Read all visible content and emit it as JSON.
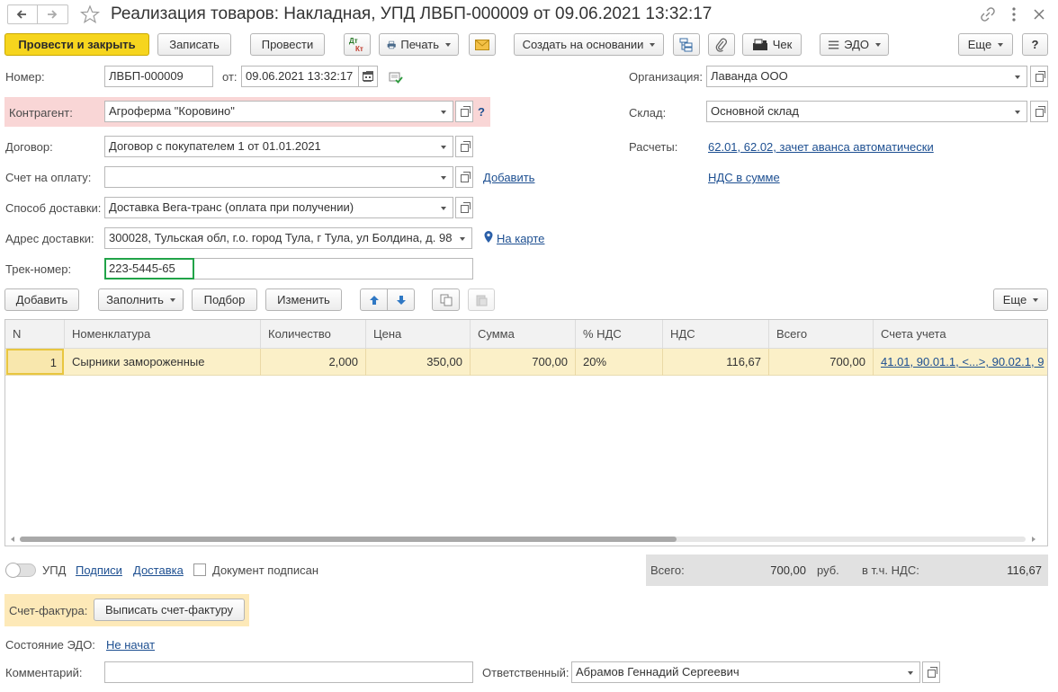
{
  "window": {
    "title": "Реализация товаров: Накладная, УПД ЛВБП-000009 от 09.06.2021 13:32:17"
  },
  "toolbar": {
    "post_close": "Провести и закрыть",
    "save": "Записать",
    "post": "Провести",
    "dtkt_top": "Дт",
    "dtkt_bottom": "Кт",
    "print": "Печать",
    "create_based": "Создать на основании",
    "check": "Чек",
    "edo": "ЭДО",
    "more": "Еще",
    "help": "?"
  },
  "header": {
    "number_label": "Номер:",
    "number_value": "ЛВБП-000009",
    "from_label": "от:",
    "date_value": "09.06.2021 13:32:17",
    "org_label": "Организация:",
    "org_value": "Лаванда ООО",
    "counterparty_label": "Контрагент:",
    "counterparty_value": "Агроферма \"Коровино\"",
    "help_q": "?",
    "warehouse_label": "Склад:",
    "warehouse_value": "Основной склад",
    "contract_label": "Договор:",
    "contract_value": "Договор с покупателем 1 от 01.01.2021",
    "settlements_label": "Расчеты:",
    "settlements_link": "62.01, 62.02, зачет аванса автоматически",
    "invoice_label": "Счет на оплату:",
    "invoice_value": "",
    "add_link": "Добавить",
    "vat_link": "НДС в сумме",
    "delivery_method_label": "Способ доставки:",
    "delivery_method_value": "Доставка Вега-транс (оплата при получении)",
    "delivery_address_label": "Адрес доставки:",
    "delivery_address_value": "300028, Тульская обл, г.о. город Тула, г Тула, ул Болдина, д. 98",
    "map_link": "На карте",
    "track_label": "Трек-номер:",
    "track_value": "223-5445-65"
  },
  "table_toolbar": {
    "add": "Добавить",
    "fill": "Заполнить",
    "pick": "Подбор",
    "change": "Изменить",
    "more": "Еще"
  },
  "table": {
    "columns": [
      "N",
      "Номенклатура",
      "Количество",
      "Цена",
      "Сумма",
      "% НДС",
      "НДС",
      "Всего",
      "Счета учета"
    ],
    "rows": [
      {
        "n": "1",
        "item": "Сырники замороженные",
        "qty": "2,000",
        "price": "350,00",
        "sum": "700,00",
        "vat_rate": "20%",
        "vat": "116,67",
        "total": "700,00",
        "accounts": "41.01, 90.01.1, <...>, 90.02.1, 9"
      }
    ]
  },
  "footer": {
    "upd_label": "УПД",
    "signatures_link": "Подписи",
    "delivery_link": "Доставка",
    "signed_label": "Документ подписан",
    "total_label": "Всего:",
    "total_value": "700,00",
    "currency": "руб.",
    "vat_label": "в т.ч. НДС:",
    "vat_value": "116,67",
    "invoice_label": "Счет-фактура:",
    "invoice_button": "Выписать счет-фактуру",
    "edo_state_label": "Состояние ЭДО:",
    "edo_state_link": "Не начат",
    "comment_label": "Комментарий:",
    "comment_value": "",
    "responsible_label": "Ответственный:",
    "responsible_value": "Абрамов Геннадий Сергеевич"
  },
  "colors": {
    "primary_button": "#f6d51e",
    "link": "#1d4f91",
    "counterparty_highlight": "#f9d6d6",
    "selected_row": "#fbf0c8",
    "track_border": "#21a348",
    "invoice_panel": "#fde9b8",
    "totals_panel": "#e1e1e1"
  }
}
